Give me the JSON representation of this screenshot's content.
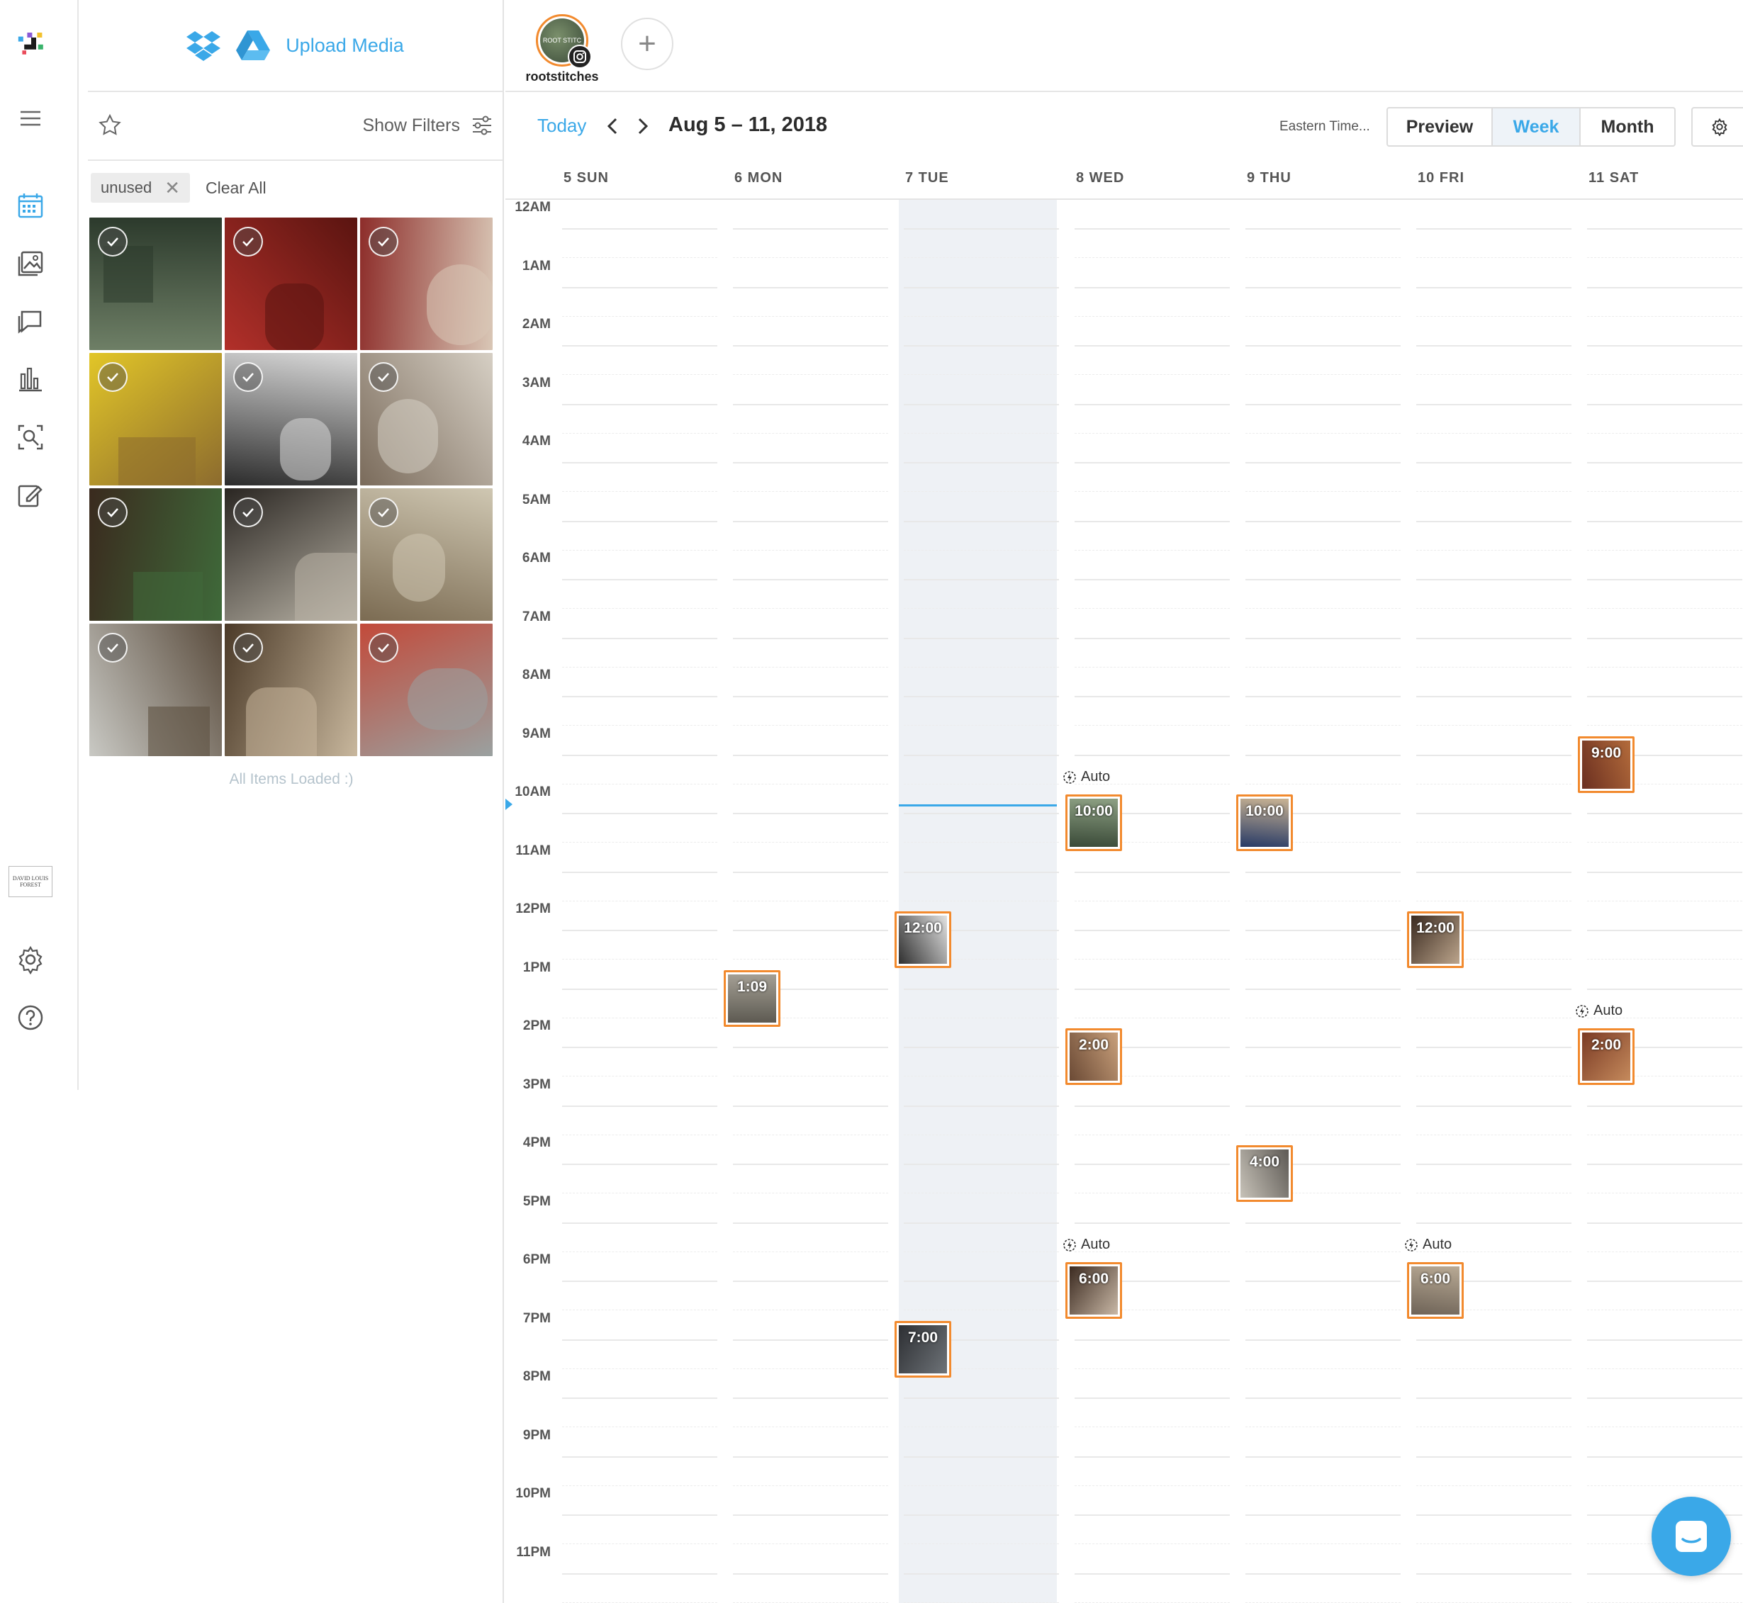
{
  "nav": {
    "items": [
      "menu-icon",
      "calendar-icon",
      "media-library-icon",
      "conversations-icon",
      "analytics-icon",
      "discover-icon",
      "link-in-bio-icon",
      "settings-icon",
      "help-icon"
    ],
    "brand_badge": "DAVID LOUIS FOREST"
  },
  "media_panel": {
    "upload_label": "Upload Media",
    "show_filters_label": "Show Filters",
    "active_filter": "unused",
    "clear_all_label": "Clear All",
    "all_loaded_text": "All Items Loaded :)",
    "tiles": [
      {
        "theme": "leaves",
        "c1": "#6e7f66",
        "c2": "#2c3a2c"
      },
      {
        "theme": "space-art",
        "c1": "#b2302a",
        "c2": "#5a1410"
      },
      {
        "theme": "textile",
        "c1": "#8d2d2a",
        "c2": "#d9c7b6"
      },
      {
        "theme": "yellow-knit",
        "c1": "#e2c628",
        "c2": "#8c6b2e"
      },
      {
        "theme": "dark-room",
        "c1": "#2c2c2c",
        "c2": "#d9d9d9"
      },
      {
        "theme": "studio",
        "c1": "#7a6b5b",
        "c2": "#d6cfc4"
      },
      {
        "theme": "portrait-leaf",
        "c1": "#3a2a1e",
        "c2": "#3f6a3a"
      },
      {
        "theme": "silver-figure",
        "c1": "#2a2622",
        "c2": "#b9b3a6"
      },
      {
        "theme": "park",
        "c1": "#7b6b52",
        "c2": "#cfc7b2"
      },
      {
        "theme": "bare-trees",
        "c1": "#c9c9c4",
        "c2": "#5a4c3d"
      },
      {
        "theme": "fence",
        "c1": "#4b3a28",
        "c2": "#c8b79d"
      },
      {
        "theme": "puffer",
        "c1": "#c24a3a",
        "c2": "#9aa1a0"
      }
    ]
  },
  "profile": {
    "handle": "rootstitches",
    "avatar_text": "ROOT STITC",
    "add_label": "+"
  },
  "calendar": {
    "today_label": "Today",
    "date_range": "Aug 5 – 11, 2018",
    "timezone": "Eastern Time...",
    "views": [
      "Preview",
      "Week",
      "Month"
    ],
    "active_view": "Week",
    "days": [
      "5 SUN",
      "6 MON",
      "7 TUE",
      "8 WED",
      "9 THU",
      "10 FRI",
      "11 SAT"
    ],
    "today_index": 2,
    "hours": [
      "12AM",
      "1AM",
      "2AM",
      "3AM",
      "4AM",
      "5AM",
      "6AM",
      "7AM",
      "8AM",
      "9AM",
      "10AM",
      "11AM",
      "12PM",
      "1PM",
      "2PM",
      "3PM",
      "4PM",
      "5PM",
      "6PM",
      "7PM",
      "8PM",
      "9PM",
      "10PM",
      "11PM"
    ],
    "current_time_hour": 10.1,
    "auto_label": "Auto",
    "accent": "#3aa8e8",
    "post_border": "#f28a2e",
    "posts": [
      {
        "day": 1,
        "hour": 13.0,
        "time": "1:09",
        "c1": "#5d5a52",
        "c2": "#a49f94",
        "auto": false
      },
      {
        "day": 2,
        "hour": 12.0,
        "time": "12:00",
        "c1": "#2f2f2f",
        "c2": "#e2e2e2",
        "auto": false
      },
      {
        "day": 2,
        "hour": 19.0,
        "time": "7:00",
        "c1": "#2d2f33",
        "c2": "#6e7378",
        "auto": false
      },
      {
        "day": 3,
        "hour": 10.0,
        "time": "10:00",
        "c1": "#3a4a38",
        "c2": "#8da083",
        "auto": true
      },
      {
        "day": 3,
        "hour": 14.0,
        "time": "2:00",
        "c1": "#6b4a35",
        "c2": "#c9a07b",
        "auto": false
      },
      {
        "day": 3,
        "hour": 18.0,
        "time": "6:00",
        "c1": "#3b2a20",
        "c2": "#c9b8a6",
        "auto": true
      },
      {
        "day": 4,
        "hour": 10.0,
        "time": "10:00",
        "c1": "#273a66",
        "c2": "#c9b393",
        "auto": false
      },
      {
        "day": 4,
        "hour": 16.0,
        "time": "4:00",
        "c1": "#c7c2b8",
        "c2": "#5e5a55",
        "auto": false
      },
      {
        "day": 5,
        "hour": 12.0,
        "time": "12:00",
        "c1": "#3a2a20",
        "c2": "#bca58c",
        "auto": false
      },
      {
        "day": 5,
        "hour": 18.0,
        "time": "6:00",
        "c1": "#6e6357",
        "c2": "#b9aa95",
        "auto": true
      },
      {
        "day": 6,
        "hour": 9.0,
        "time": "9:00",
        "c1": "#6b2f20",
        "c2": "#b36b3b",
        "auto": false
      },
      {
        "day": 6,
        "hour": 14.0,
        "time": "2:00",
        "c1": "#7a3a24",
        "c2": "#c58a5c",
        "auto": true
      }
    ]
  }
}
